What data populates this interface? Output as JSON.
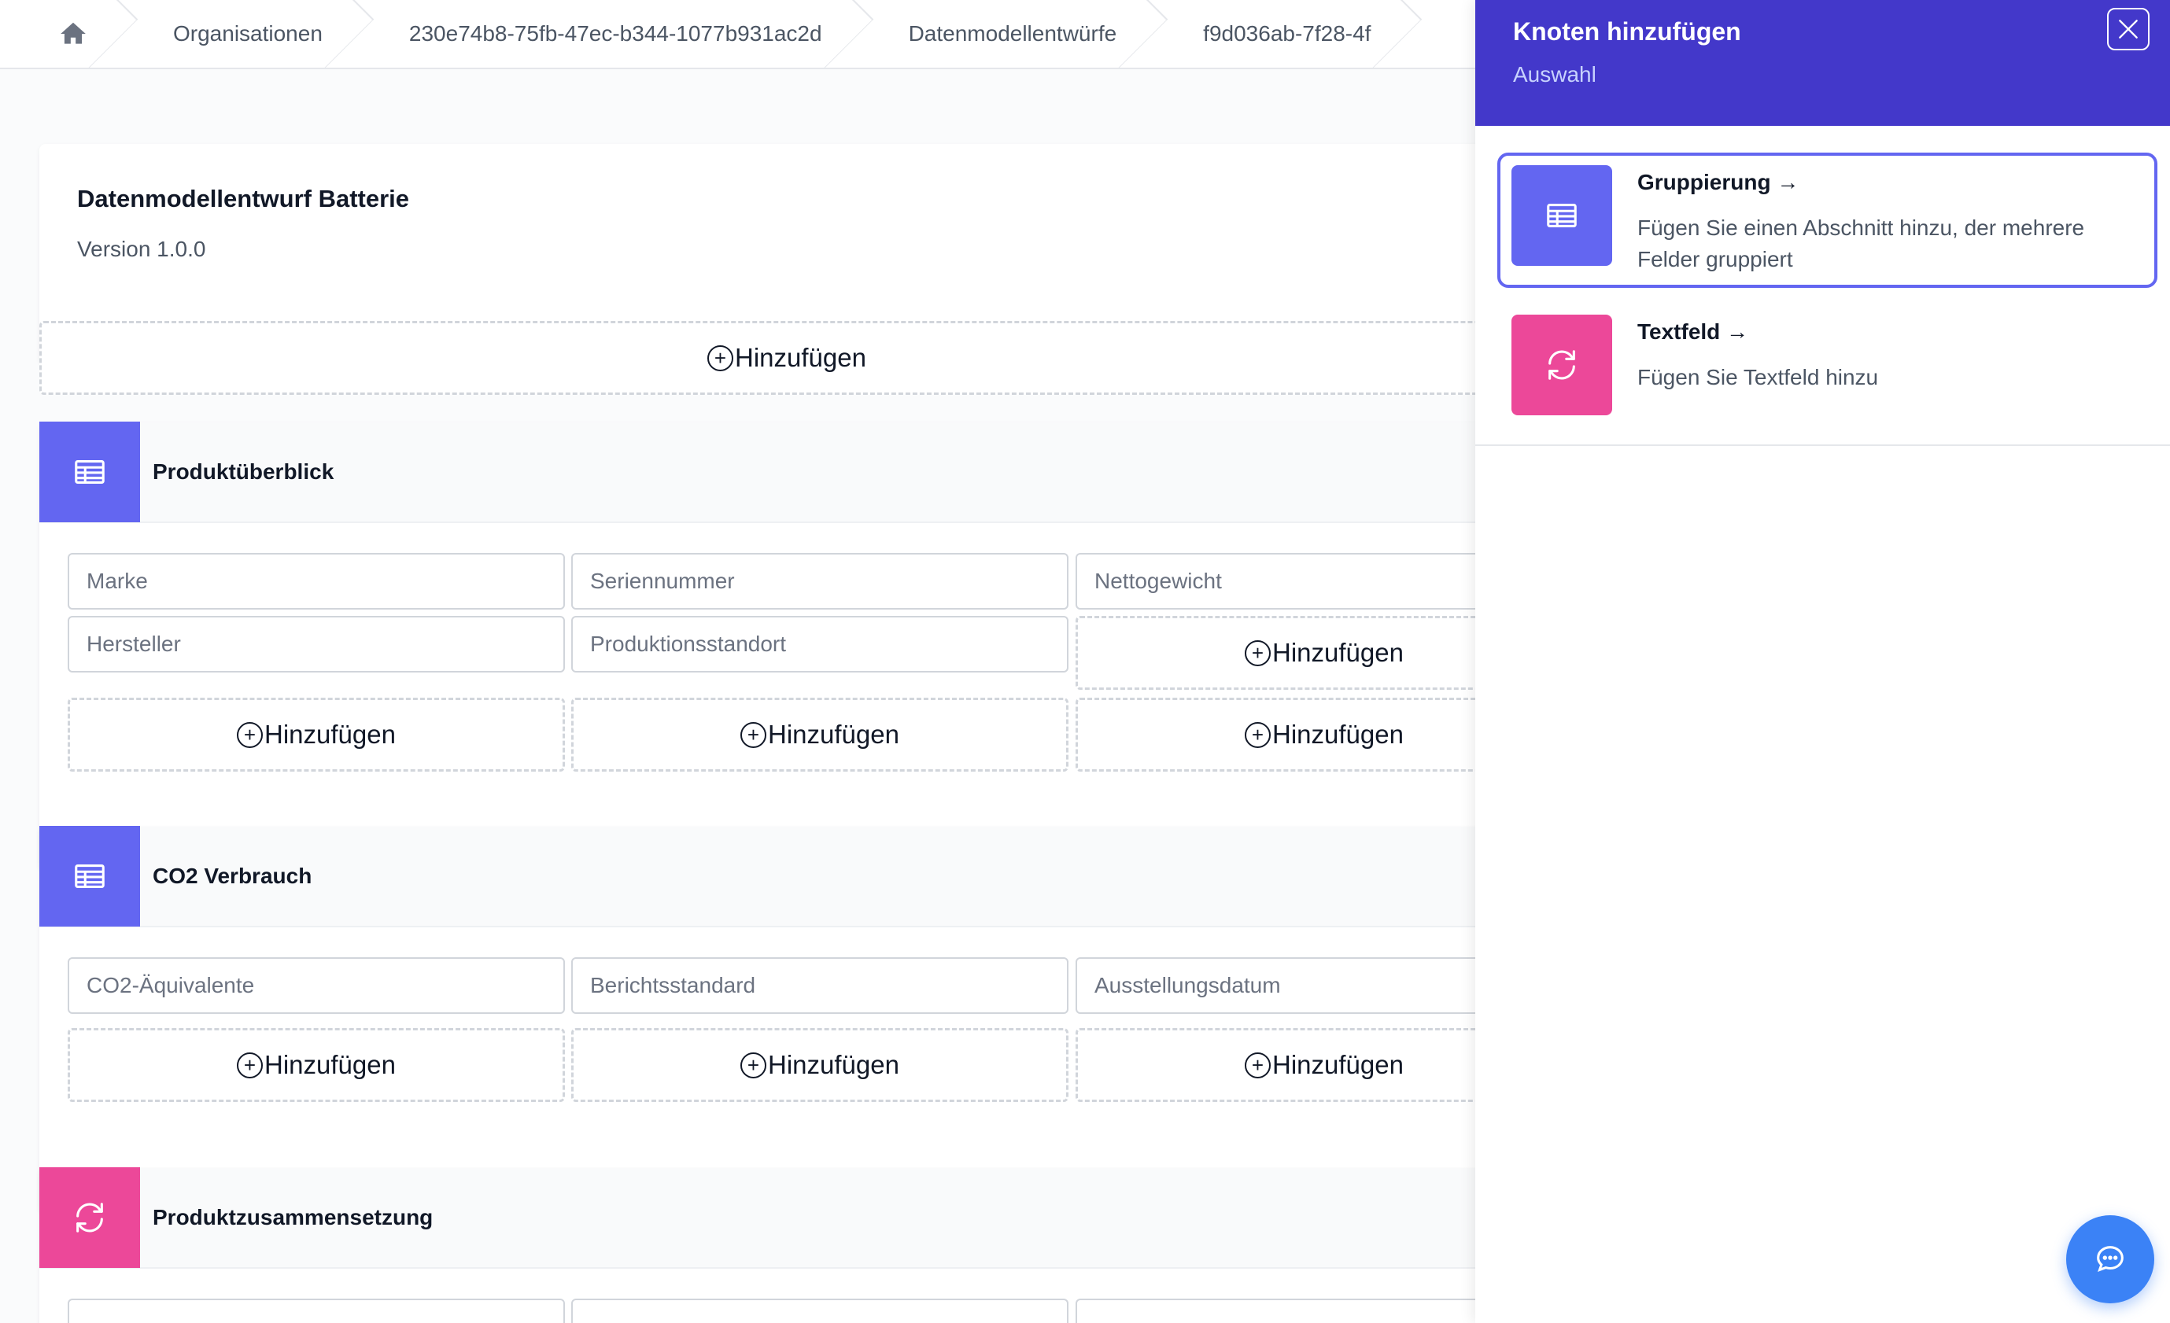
{
  "breadcrumb": {
    "items": [
      "Organisationen",
      "230e74b8-75fb-47ec-b344-1077b931ac2d",
      "Datenmodellentwürfe",
      "f9d036ab-7f28-4f"
    ]
  },
  "draft": {
    "title": "Datenmodellentwurf Batterie",
    "version": "Version 1.0.0"
  },
  "add_label": "Hinzufügen",
  "sections": [
    {
      "title": "Produktüberblick",
      "icon": "table-icon",
      "fields": [
        "Marke",
        "Seriennummer",
        "Nettogewicht",
        "Hersteller",
        "Produktionsstandort"
      ]
    },
    {
      "title": "CO2 Verbrauch",
      "icon": "table-icon",
      "fields": [
        "CO2-Äquivalente",
        "Berichtsstandard",
        "Ausstellungsdatum"
      ]
    },
    {
      "title": "Produktzusammensetzung",
      "icon": "refresh-icon",
      "fields": []
    }
  ],
  "panel": {
    "title": "Knoten hinzufügen",
    "subtitle": "Auswahl",
    "options": [
      {
        "title": "Gruppierung →",
        "description": "Fügen Sie einen Abschnitt hinzu, der mehrere Felder gruppiert",
        "icon": "table-icon"
      },
      {
        "title": "Textfeld →",
        "description": "Fügen Sie Textfeld hinzu",
        "icon": "refresh-icon"
      }
    ]
  },
  "colors": {
    "indigo": "#6366f1",
    "pink": "#ec4899",
    "panel_header": "#4338ca",
    "chat_button": "#3b82f6"
  }
}
